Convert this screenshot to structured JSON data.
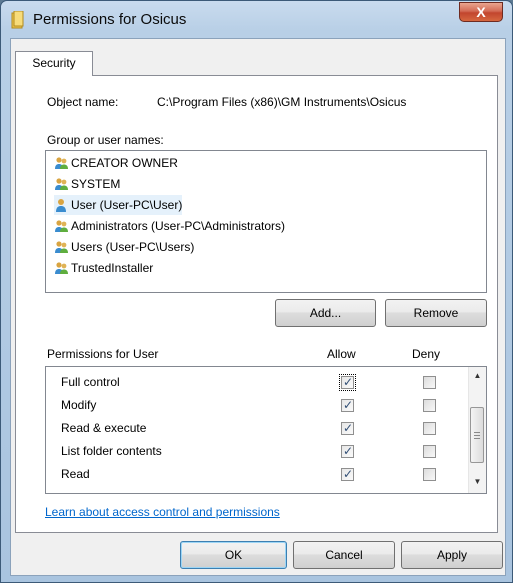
{
  "window": {
    "title": "Permissions for Osicus",
    "close_label": "X"
  },
  "tab": {
    "label": "Security"
  },
  "object": {
    "label": "Object name:",
    "value": "C:\\Program Files (x86)\\GM Instruments\\Osicus"
  },
  "group_label": "Group or user names:",
  "users": [
    {
      "name": "CREATOR OWNER",
      "icon": "group-icon"
    },
    {
      "name": "SYSTEM",
      "icon": "group-icon"
    },
    {
      "name": "User (User-PC\\User)",
      "icon": "user-icon"
    },
    {
      "name": "Administrators (User-PC\\Administrators)",
      "icon": "group-icon"
    },
    {
      "name": "Users (User-PC\\Users)",
      "icon": "group-icon"
    },
    {
      "name": "TrustedInstaller",
      "icon": "group-icon"
    }
  ],
  "buttons": {
    "add": "Add...",
    "remove": "Remove",
    "ok": "OK",
    "cancel": "Cancel",
    "apply": "Apply"
  },
  "permissions": {
    "header": "Permissions for User",
    "allow_header": "Allow",
    "deny_header": "Deny",
    "rows": [
      {
        "name": "Full control",
        "allow": true,
        "deny": false
      },
      {
        "name": "Modify",
        "allow": true,
        "deny": false
      },
      {
        "name": "Read & execute",
        "allow": true,
        "deny": false
      },
      {
        "name": "List folder contents",
        "allow": true,
        "deny": false
      },
      {
        "name": "Read",
        "allow": true,
        "deny": false
      }
    ]
  },
  "link": "Learn about access control and permissions",
  "colors": {
    "link": "#0066cc",
    "title_close": "#c2452e",
    "selection": "#e5f1fb"
  }
}
